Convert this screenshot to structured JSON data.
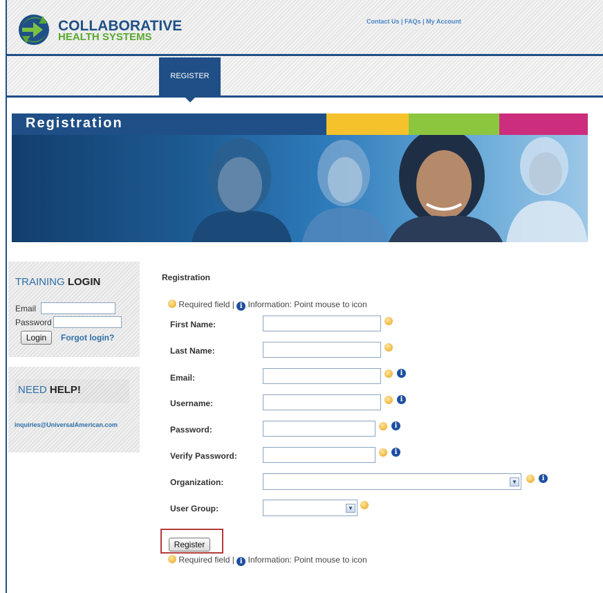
{
  "header": {
    "logo_line1": "COLLABORATIVE",
    "logo_line2": "HEALTH SYSTEMS",
    "links": [
      "Contact Us",
      "FAQs",
      "My Account"
    ],
    "separator": "|"
  },
  "nav": {
    "items": [
      "REGISTER"
    ]
  },
  "banner": {
    "title": "Registration",
    "bar_colors": [
      "#1f4f86",
      "#f5c22c",
      "#8cc63f",
      "#cc2e7d"
    ]
  },
  "training_login": {
    "title_part1": "TRAINING",
    "title_part2": "LOGIN",
    "email_label": "Email",
    "email_value": "",
    "password_label": "Password",
    "password_value": "",
    "login_button": "Login",
    "forgot_link": "Forgot login?"
  },
  "need_help": {
    "title_part1": "NEED",
    "title_part2": "HELP!",
    "email": "inquiries@UniversalAmerican.com"
  },
  "form": {
    "title": "Registration",
    "legend_required": "Required field |",
    "legend_info": "Information: Point mouse to icon",
    "fields": [
      {
        "label": "First Name:",
        "value": "",
        "required": true,
        "info": false
      },
      {
        "label": "Last Name:",
        "value": "",
        "required": true,
        "info": false
      },
      {
        "label": "Email:",
        "value": "",
        "required": true,
        "info": true
      },
      {
        "label": "Username:",
        "value": "",
        "required": true,
        "info": true
      },
      {
        "label": "Password:",
        "value": "",
        "required": true,
        "info": true
      },
      {
        "label": "Verify Password:",
        "value": "",
        "required": true,
        "info": true
      },
      {
        "label": "Organization:",
        "value": "",
        "required": true,
        "info": true
      },
      {
        "label": "User Group:",
        "value": "",
        "required": true,
        "info": false
      }
    ],
    "register_button": "Register"
  },
  "icons": {
    "required": "required-icon",
    "info": "info-icon",
    "dropdown": "chevron-down-icon"
  },
  "colors": {
    "brand_blue": "#1f4f86",
    "link_blue": "#2f6fa8",
    "logo_green": "#5aa830",
    "required_orange": "#e8a21a",
    "highlight_red": "#b33a3a"
  }
}
